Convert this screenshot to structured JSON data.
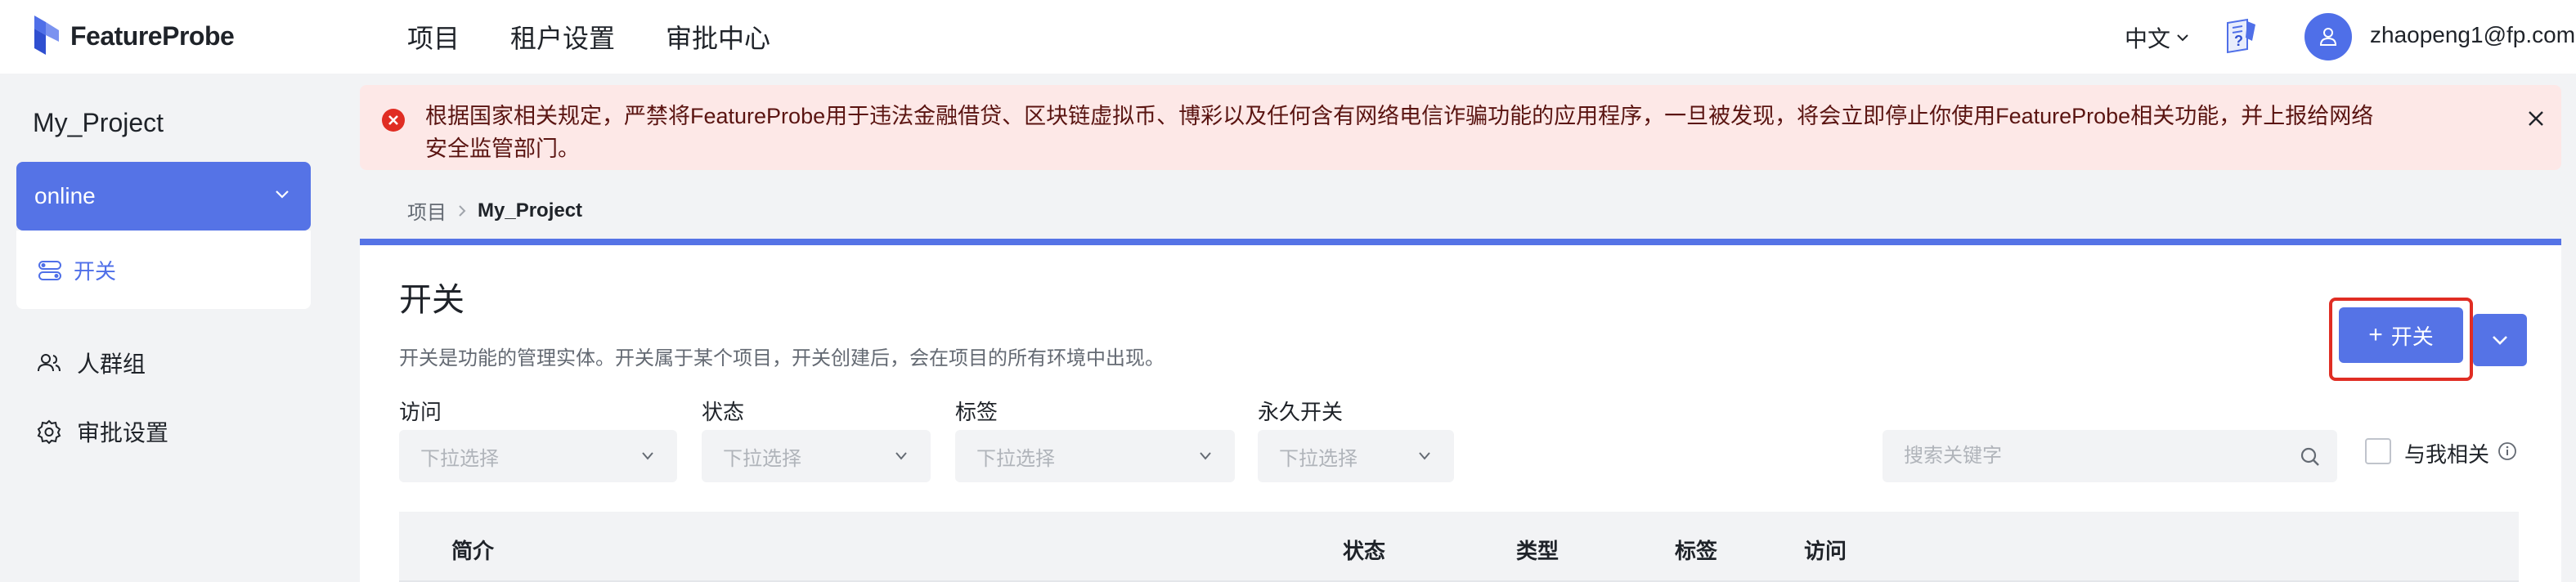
{
  "header": {
    "logo_text": "FeatureProbe",
    "nav": [
      "项目",
      "租户设置",
      "审批中心"
    ],
    "language": "中文",
    "user_email": "zhaopeng1@fp.com"
  },
  "sidebar": {
    "project_name": "My_Project",
    "environment": "online",
    "env_items": [
      {
        "label": "开关",
        "icon": "toggle-icon"
      }
    ],
    "links": [
      {
        "label": "人群组",
        "icon": "users-icon"
      },
      {
        "label": "审批设置",
        "icon": "gear-icon"
      }
    ]
  },
  "alert": {
    "text": "根据国家相关规定，严禁将FeatureProbe用于违法金融借贷、区块链虚拟币、博彩以及任何含有网络电信诈骗功能的应用程序，一旦被发现，将会立即停止你使用FeatureProbe相关功能，并上报给网络安全监管部门。"
  },
  "breadcrumb": {
    "root": "项目",
    "current": "My_Project"
  },
  "toggles": {
    "title": "开关",
    "description": "开关是功能的管理实体。开关属于某个项目，开关创建后，会在项目的所有环境中出现。",
    "add_button": "开关",
    "filters": [
      {
        "label": "访问",
        "placeholder": "下拉选择"
      },
      {
        "label": "状态",
        "placeholder": "下拉选择"
      },
      {
        "label": "标签",
        "placeholder": "下拉选择"
      },
      {
        "label": "永久开关",
        "placeholder": "下拉选择"
      }
    ],
    "search_placeholder": "搜索关键字",
    "related_to_me": "与我相关",
    "columns": [
      "简介",
      "状态",
      "类型",
      "标签",
      "访问"
    ]
  },
  "colors": {
    "primary": "#5573e6",
    "alert_bg": "#fde8e7",
    "alert_icon": "#e02d23",
    "highlight_outline": "#e02d23"
  }
}
